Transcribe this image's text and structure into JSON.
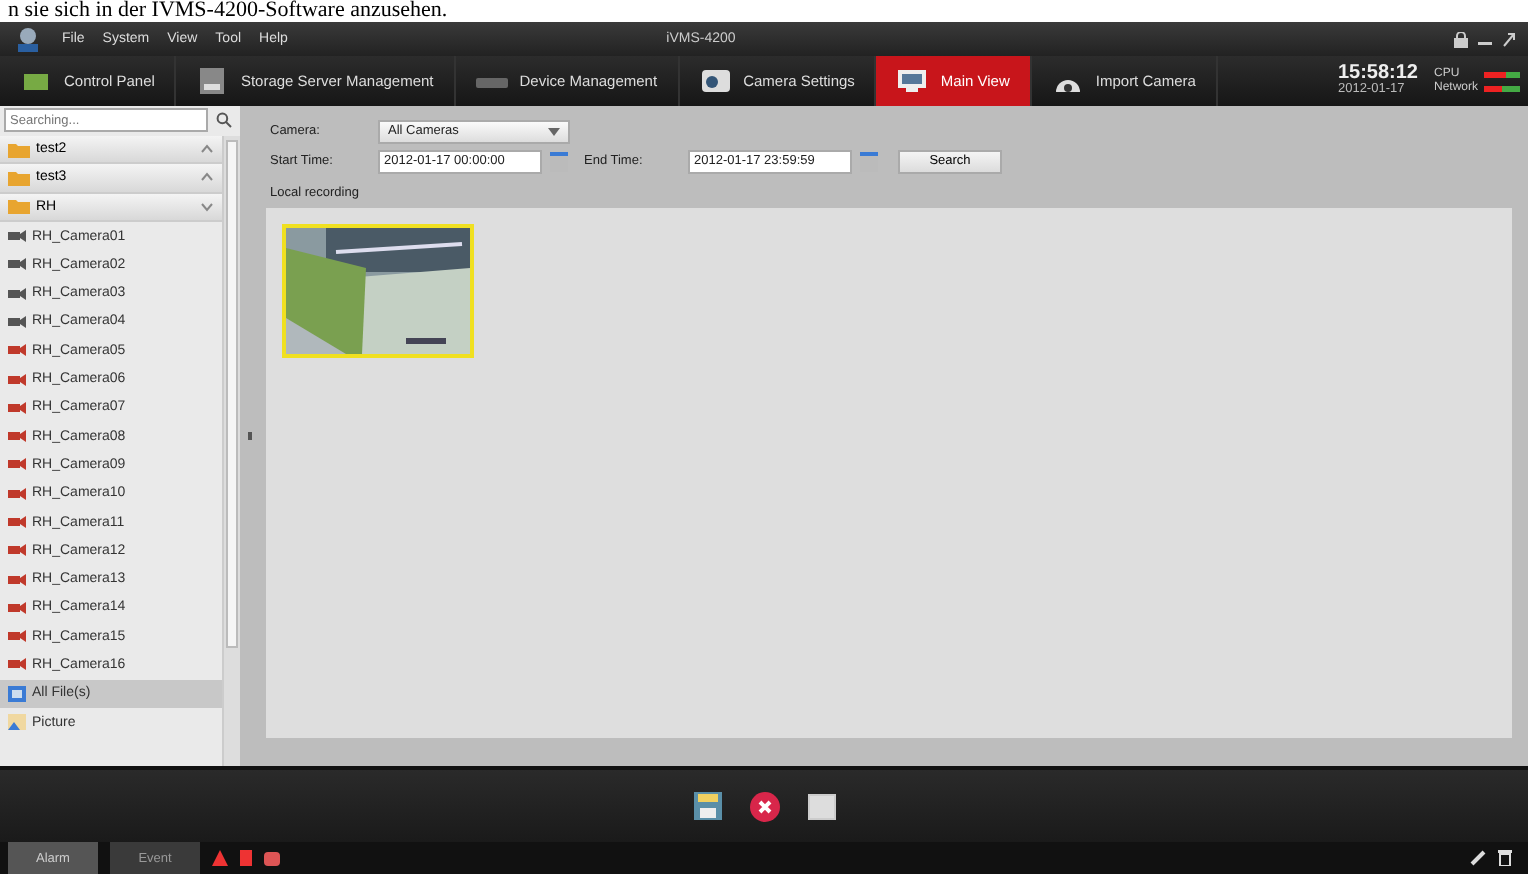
{
  "doc_caption": "n sie sich in der IVMS-4200-Software anzusehen.",
  "window": {
    "title": "iVMS-4200"
  },
  "menu": [
    "File",
    "System",
    "View",
    "Tool",
    "Help"
  ],
  "tabs": [
    {
      "label": "Control Panel",
      "selected": false,
      "kind": "panel"
    },
    {
      "label": "Storage Server Management",
      "selected": false,
      "kind": "storage"
    },
    {
      "label": "Device Management",
      "selected": false,
      "kind": "device"
    },
    {
      "label": "Camera Settings",
      "selected": false,
      "kind": "camera"
    },
    {
      "label": "Main View",
      "selected": true,
      "kind": "monitor"
    },
    {
      "label": "Import Camera",
      "selected": false,
      "kind": "dome"
    }
  ],
  "clock": {
    "time": "15:58:12",
    "date": "2012-01-17"
  },
  "meters": [
    {
      "label": "CPU",
      "level": 0.6
    },
    {
      "label": "Network",
      "level": 0.5
    }
  ],
  "sidebar": {
    "search": {
      "placeholder": "Searching..."
    },
    "tree": [
      {
        "label": "test2",
        "expanded": false
      },
      {
        "label": "test3",
        "expanded": false
      },
      {
        "label": "RH",
        "expanded": true,
        "children": [
          {
            "label": "RH_Camera01",
            "color": "#555555"
          },
          {
            "label": "RH_Camera02",
            "color": "#555555"
          },
          {
            "label": "RH_Camera03",
            "color": "#555555"
          },
          {
            "label": "RH_Camera04",
            "color": "#555555"
          },
          {
            "label": "RH_Camera05",
            "color": "#c0392b"
          },
          {
            "label": "RH_Camera06",
            "color": "#c0392b"
          },
          {
            "label": "RH_Camera07",
            "color": "#c0392b"
          },
          {
            "label": "RH_Camera08",
            "color": "#c0392b"
          },
          {
            "label": "RH_Camera09",
            "color": "#c0392b"
          },
          {
            "label": "RH_Camera10",
            "color": "#c0392b"
          },
          {
            "label": "RH_Camera11",
            "color": "#c0392b"
          },
          {
            "label": "RH_Camera12",
            "color": "#c0392b"
          },
          {
            "label": "RH_Camera13",
            "color": "#c0392b"
          },
          {
            "label": "RH_Camera14",
            "color": "#c0392b"
          },
          {
            "label": "RH_Camera15",
            "color": "#c0392b"
          },
          {
            "label": "RH_Camera16",
            "color": "#c0392b"
          }
        ]
      }
    ],
    "file_types": [
      {
        "label": "All File(s)",
        "selected": true,
        "kind": "files"
      },
      {
        "label": "Picture",
        "selected": false,
        "kind": "picture"
      }
    ]
  },
  "filter": {
    "camera_label": "Camera:",
    "camera_value": "All Cameras",
    "start_label": "Start Time:",
    "start_value": "2012-01-17 00:00:00",
    "end_label": "End Time:",
    "end_value": "2012-01-17 23:59:59",
    "search_button": "Search"
  },
  "section_title": "Local recording",
  "recordings": [
    {
      "kind": "picture",
      "selected": true
    }
  ],
  "status_tabs": [
    {
      "label": "Alarm",
      "selected": true
    },
    {
      "label": "Event",
      "selected": false
    }
  ]
}
